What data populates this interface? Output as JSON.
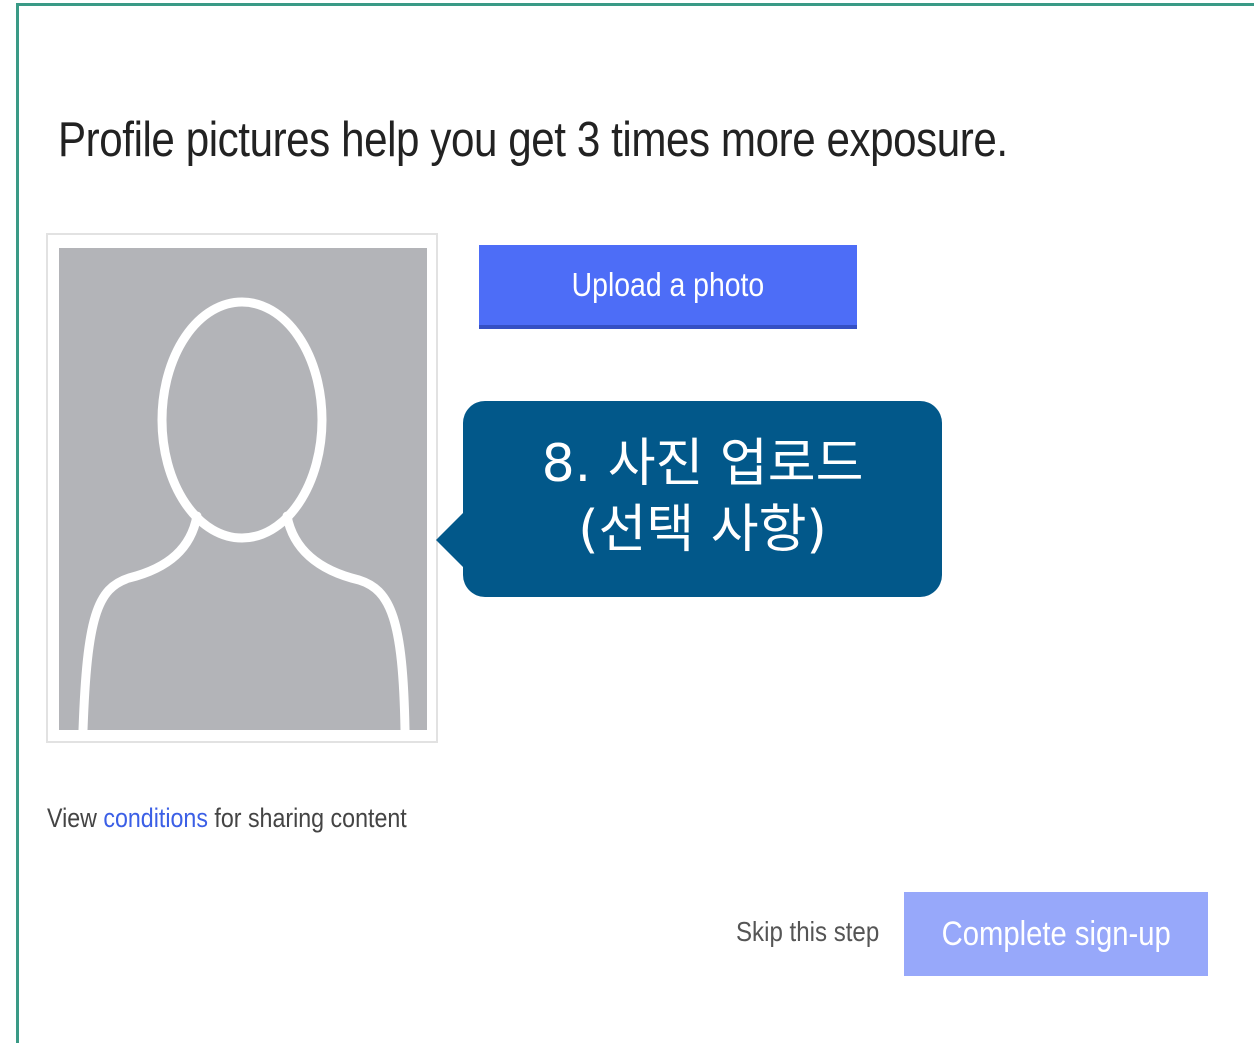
{
  "dialog": {
    "headline": "Profile pictures help you get 3 times more exposure.",
    "upload_label": "Upload a photo",
    "callout": {
      "line1": "8. 사진 업로드",
      "line2": "(선택 사항)"
    },
    "conditions": {
      "prefix": "View ",
      "link": "conditions",
      "suffix": " for sharing content"
    },
    "skip_label": "Skip this step",
    "complete_label": "Complete sign-up"
  },
  "icons": {
    "avatar_placeholder": "person-silhouette-icon"
  },
  "colors": {
    "frame_border": "#3a9a86",
    "upload_button": "#4d6df7",
    "complete_button": "#97a8fa",
    "callout": "#02588a",
    "link": "#3b5fe6"
  }
}
